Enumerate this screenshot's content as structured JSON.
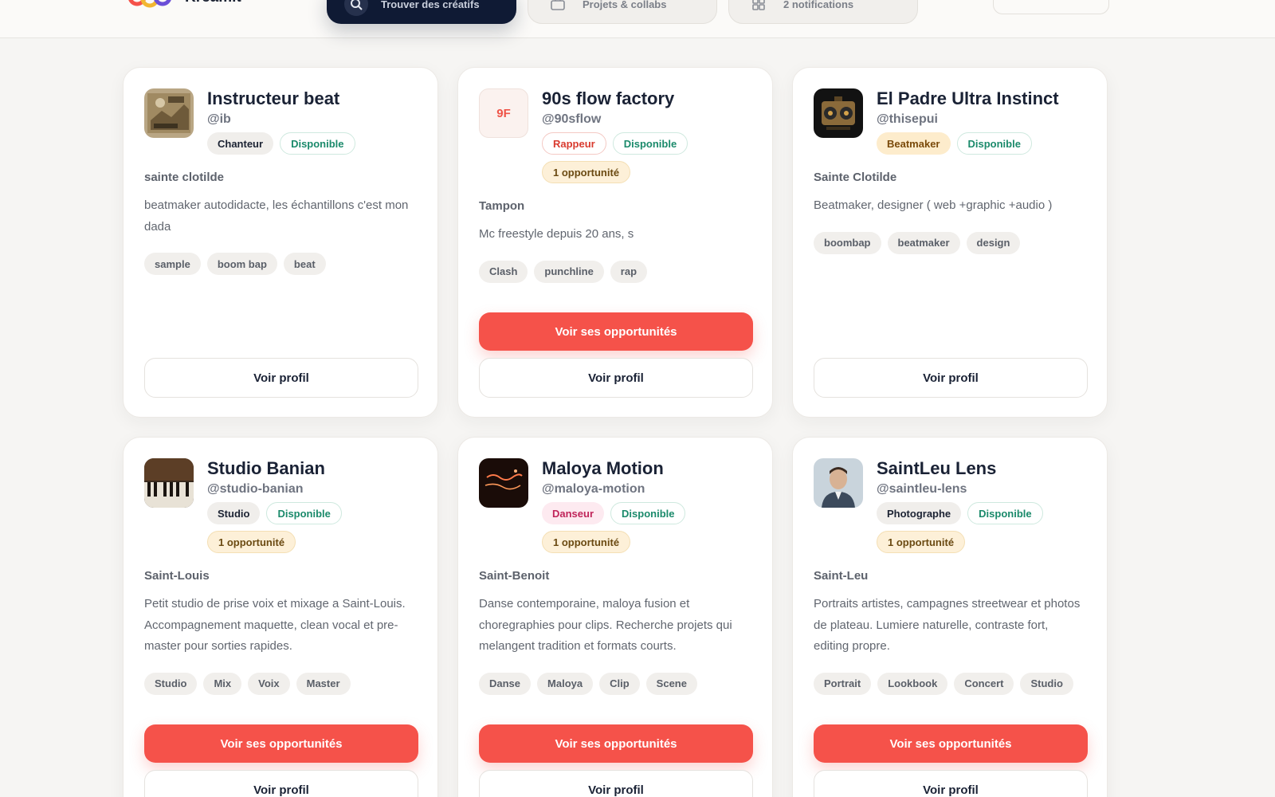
{
  "brand": {
    "name": "Kreamit"
  },
  "nav": [
    {
      "label": "Trouver des créatifs",
      "icon": "search-icon",
      "active": true
    },
    {
      "label": "Projets & collabs",
      "icon": "briefcase-icon",
      "active": false
    },
    {
      "label": "2 notifications",
      "icon": "grid-icon",
      "active": false
    }
  ],
  "colors": {
    "accent": "#f5524a",
    "navy": "#0f1a34",
    "available": "#1b8a6b"
  },
  "cards": [
    {
      "name": "Instructeur beat",
      "handle": "@ib",
      "avatar": "vintage-map-image",
      "role": "Chanteur",
      "availability": "Disponible",
      "opportunity": "",
      "location": "sainte clotilde",
      "bio": "beatmaker autodidacte, les échantillons c'est mon dada",
      "tags": [
        "sample",
        "boom bap",
        "beat"
      ],
      "opp_button": "",
      "profile_button": "Voir profil"
    },
    {
      "name": "90s flow factory",
      "handle": "@90sflow",
      "avatar_initials": "9F",
      "role": "Rappeur",
      "availability": "Disponible",
      "opportunity": "1 opportunité",
      "location": "Tampon",
      "bio": "Mc freestyle depuis 20 ans, s",
      "tags": [
        "Clash",
        "punchline",
        "rap"
      ],
      "opp_button": "Voir ses opportunités",
      "profile_button": "Voir profil"
    },
    {
      "name": "El Padre Ultra Instinct",
      "handle": "@thisepui",
      "avatar": "boombox-illustration",
      "role": "Beatmaker",
      "availability": "Disponible",
      "opportunity": "",
      "location": "Sainte Clotilde",
      "bio": "Beatmaker, designer ( web +graphic +audio )",
      "tags": [
        "boombap",
        "beatmaker",
        "design"
      ],
      "opp_button": "",
      "profile_button": "Voir profil"
    },
    {
      "name": "Studio Banian",
      "handle": "@studio-banian",
      "avatar": "piano-photo",
      "role": "Studio",
      "availability": "Disponible",
      "opportunity": "1 opportunité",
      "location": "Saint-Louis",
      "bio": "Petit studio de prise voix et mixage a Saint-Louis. Accompagnement maquette, clean vocal et pre-master pour sorties rapides.",
      "tags": [
        "Studio",
        "Mix",
        "Voix",
        "Master"
      ],
      "opp_button": "Voir ses opportunités",
      "profile_button": "Voir profil"
    },
    {
      "name": "Maloya Motion",
      "handle": "@maloya-motion",
      "avatar": "neon-sign-photo",
      "role": "Danseur",
      "availability": "Disponible",
      "opportunity": "1 opportunité",
      "location": "Saint-Benoit",
      "bio": "Danse contemporaine, maloya fusion et choregraphies pour clips. Recherche projets qui melangent tradition et formats courts.",
      "tags": [
        "Danse",
        "Maloya",
        "Clip",
        "Scene"
      ],
      "opp_button": "Voir ses opportunités",
      "profile_button": "Voir profil"
    },
    {
      "name": "SaintLeu Lens",
      "handle": "@saintleu-lens",
      "avatar": "portrait-photo",
      "role": "Photographe",
      "availability": "Disponible",
      "opportunity": "1 opportunité",
      "location": "Saint-Leu",
      "bio": "Portraits artistes, campagnes streetwear et photos de plateau. Lumiere naturelle, contraste fort, editing propre.",
      "tags": [
        "Portrait",
        "Lookbook",
        "Concert",
        "Studio"
      ],
      "opp_button": "Voir ses opportunités",
      "profile_button": "Voir profil"
    }
  ]
}
